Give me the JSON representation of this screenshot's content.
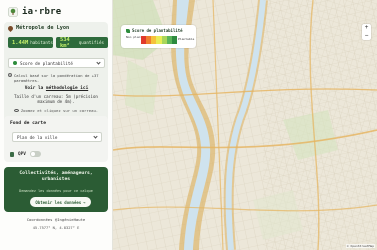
{
  "brand": {
    "name": "ia·rbre",
    "icon": "tree-icon"
  },
  "city": {
    "title": "Métropole de Lyon"
  },
  "stats": [
    {
      "value": "1.44M",
      "label": "habitants"
    },
    {
      "value": "534 km²",
      "label": "quantifiés"
    }
  ],
  "score_select": {
    "label": "Score de plantabilité"
  },
  "info": {
    "calc_note": "Calcul basé sur la pondération de +37 paramètres.",
    "method_prefix": "Voir la ",
    "method_link": "méthodologie ici",
    "cell_size": "Taille d'un carreau: 5m (précision maximum de 4m).",
    "zoom_hint": "Zoomez et cliquez sur un carreau."
  },
  "basemap": {
    "heading": "Fond de carte",
    "selected": "Plan de la ville"
  },
  "qpv": {
    "label": "QPV",
    "enabled": false
  },
  "promo": {
    "title": "Collectivités, aménageurs, urbanistes",
    "subtitle": "Demandez les données pour ce calque",
    "button": "Obtenir les données"
  },
  "credit": "Coordonnées @IngénieHaute",
  "coords": "45.7577° N, 4.8327° E",
  "legend": {
    "title": "Score de plantabilité",
    "low": "Non plantable",
    "high": "Plantable",
    "colors": [
      "#e03a2b",
      "#f07f2e",
      "#f5c23b",
      "#e9ee55",
      "#a9d65a",
      "#5bb55a",
      "#2e8b3f"
    ]
  },
  "map": {
    "zoom_in": "+",
    "zoom_out": "−",
    "attribution": "© OpenStreetMap"
  }
}
